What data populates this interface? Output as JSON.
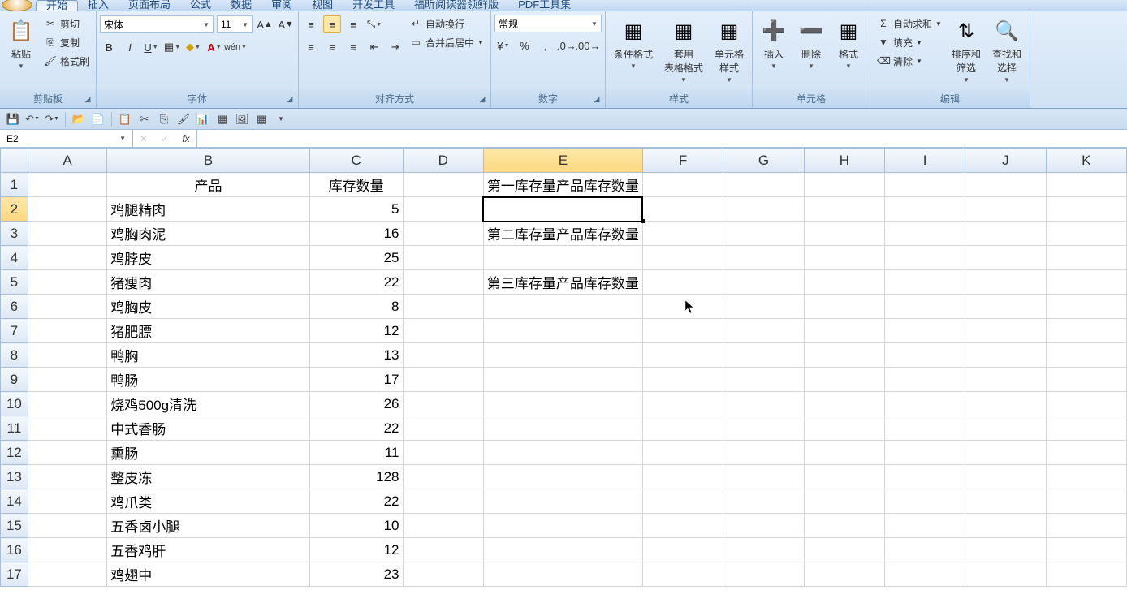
{
  "menu": {
    "tabs": [
      "开始",
      "插入",
      "页面布局",
      "公式",
      "数据",
      "审阅",
      "视图",
      "开发工具",
      "福昕阅读器领鲜版",
      "PDF工具集"
    ],
    "active": 0
  },
  "ribbon": {
    "clipboard": {
      "label": "剪贴板",
      "paste": "粘贴",
      "cut": "剪切",
      "copy": "复制",
      "format_painter": "格式刷"
    },
    "font": {
      "label": "字体",
      "name": "宋体",
      "size": "11"
    },
    "align": {
      "label": "对齐方式",
      "wrap": "自动换行",
      "merge": "合并后居中"
    },
    "number": {
      "label": "数字",
      "format": "常规"
    },
    "styles": {
      "label": "样式",
      "cond": "条件格式",
      "table": "套用\n表格格式",
      "cell": "单元格\n样式"
    },
    "cells": {
      "label": "单元格",
      "insert": "插入",
      "delete": "删除",
      "format": "格式"
    },
    "editing": {
      "label": "编辑",
      "sum": "自动求和",
      "fill": "填充",
      "clear": "清除",
      "sort": "排序和\n筛选",
      "find": "查找和\n选择"
    }
  },
  "name_box": "E2",
  "columns": [
    "A",
    "B",
    "C",
    "D",
    "E",
    "F",
    "G",
    "H",
    "I",
    "J",
    "K"
  ],
  "rows": [
    {
      "n": 1,
      "B": "产品",
      "C": "库存数量",
      "Ctxt": true,
      "E": "第一库存量产品库存数量"
    },
    {
      "n": 2,
      "B": "鸡腿精肉",
      "C": "5",
      "sel": true
    },
    {
      "n": 3,
      "B": "鸡胸肉泥",
      "C": "16",
      "E": "第二库存量产品库存数量"
    },
    {
      "n": 4,
      "B": "鸡脖皮",
      "C": "25"
    },
    {
      "n": 5,
      "B": "猪瘦肉",
      "C": "22",
      "E": "第三库存量产品库存数量"
    },
    {
      "n": 6,
      "B": "鸡胸皮",
      "C": "8"
    },
    {
      "n": 7,
      "B": "猪肥膘",
      "C": "12"
    },
    {
      "n": 8,
      "B": "鸭胸",
      "C": "13"
    },
    {
      "n": 9,
      "B": "鸭肠",
      "C": "17"
    },
    {
      "n": 10,
      "B": "烧鸡500g清洗",
      "C": "26"
    },
    {
      "n": 11,
      "B": "中式香肠",
      "C": "22"
    },
    {
      "n": 12,
      "B": "熏肠",
      "C": "11"
    },
    {
      "n": 13,
      "B": "整皮冻",
      "C": "128"
    },
    {
      "n": 14,
      "B": "鸡爪类",
      "C": "22"
    },
    {
      "n": 15,
      "B": "五香卤小腿",
      "C": "10"
    },
    {
      "n": 16,
      "B": "五香鸡肝",
      "C": "12"
    },
    {
      "n": 17,
      "B": "鸡翅中",
      "C": "23"
    }
  ],
  "selected_cell": {
    "row": 2,
    "col": "E"
  }
}
